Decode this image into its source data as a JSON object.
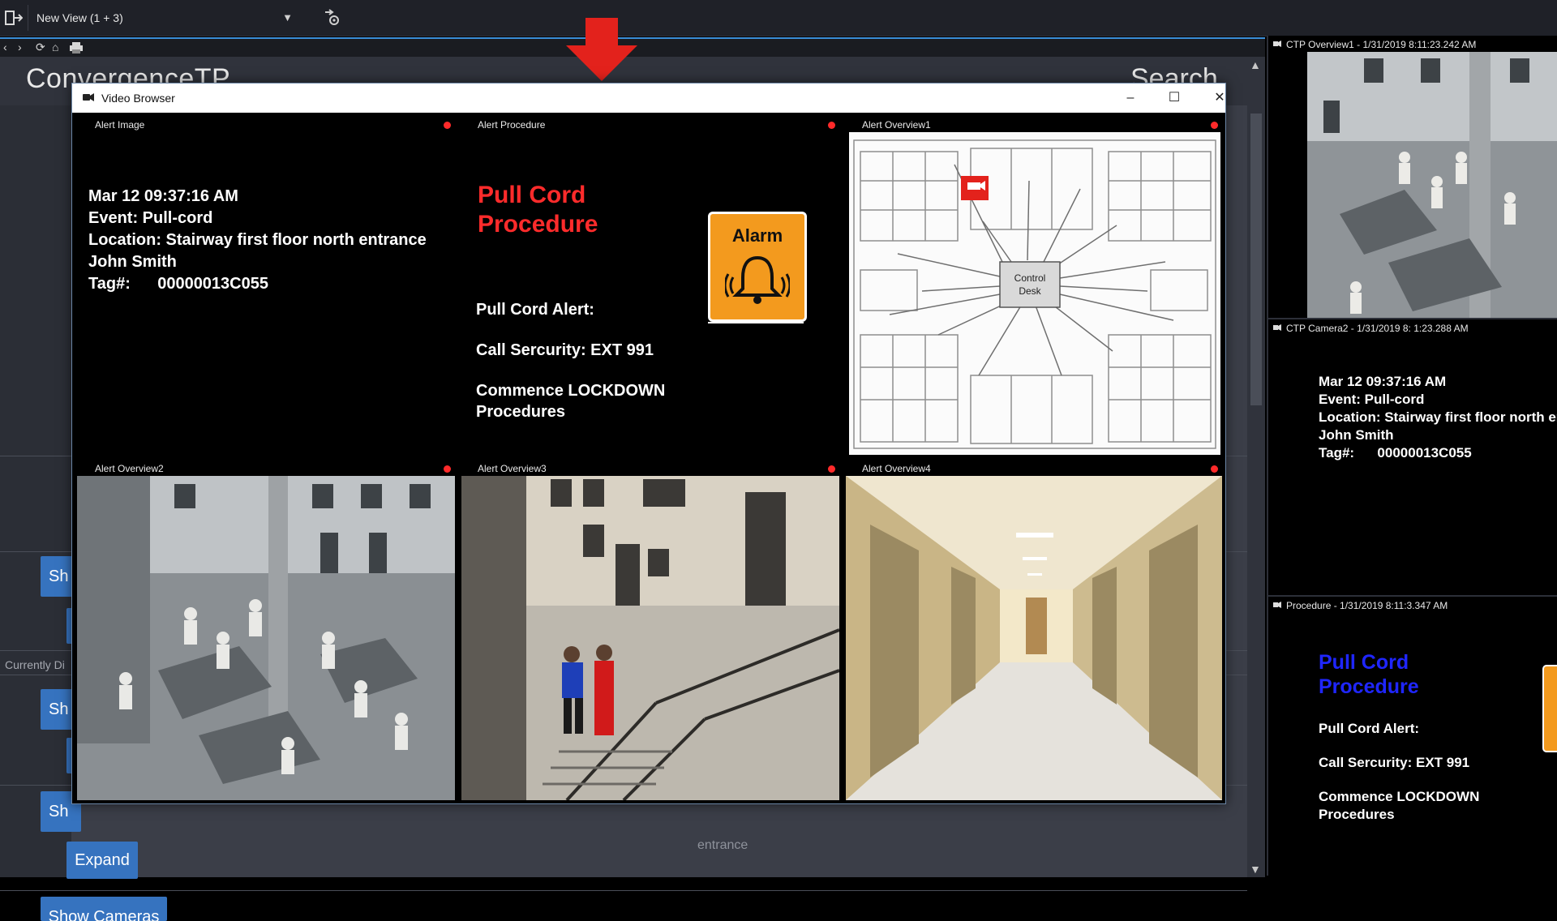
{
  "toolbar": {
    "view_name": "New View (1 + 3)"
  },
  "browser": {
    "brand": "ConvergenceTP",
    "search_heading": "Search",
    "buttons": {
      "show1": "Sh",
      "show2": "Sh",
      "show3": "Sh",
      "expand": "Expand",
      "show_cameras": "Show Cameras"
    },
    "currently_label": "Currently Di",
    "entrance_text": "entrance"
  },
  "window": {
    "title": "Video Browser",
    "minimize": "–",
    "maximize": "☐",
    "close": "✕",
    "panes": {
      "alert_image": {
        "label": "Alert Image",
        "lines": [
          "Mar 12 09:37:16 AM",
          "Event:  Pull-cord",
          "Location: Stairway first floor north entrance",
          "John Smith",
          "Tag#:      00000013C055"
        ]
      },
      "alert_procedure": {
        "label": "Alert Procedure",
        "title_line1": "Pull Cord",
        "title_line2": "Procedure",
        "alarm_word": "Alarm",
        "line1": "Pull Cord Alert:",
        "line2": "Call Sercurity: EXT 991",
        "line3a": "Commence LOCKDOWN",
        "line3b": "Procedures"
      },
      "alert_overview1": {
        "label": "Alert Overview1",
        "control_desk_line1": "Control",
        "control_desk_line2": "Desk"
      },
      "alert_overview2": {
        "label": "Alert Overview2"
      },
      "alert_overview3": {
        "label": "Alert Overview3"
      },
      "alert_overview4": {
        "label": "Alert Overview4"
      }
    }
  },
  "right_column": {
    "camera1_label": "CTP Overview1 - 1/31/2019 8:11:23.242 AM",
    "camera2_label": "CTP Camera2 - 1/31/2019 8: 1:23.288 AM",
    "camera2_lines": [
      "Mar 12 09:37:16 AM",
      "Event:  Pull-cord",
      "Location: Stairway first floor north entrance",
      "John Smith",
      "Tag#:      00000013C055"
    ],
    "procedure_label": "Procedure - 1/31/2019 8:11:3.347 AM",
    "proc_title_line1": "Pull Cord",
    "proc_title_line2": "Procedure",
    "proc_line1": "Pull Cord Alert:",
    "proc_line2": "Call Sercurity: EXT 991",
    "proc_line3a": "Commence LOCKDOWN",
    "proc_line3b": "Procedures"
  },
  "colors": {
    "accent_blue": "#3673bf",
    "alert_red": "#ff2b2b",
    "procedure_blue": "#1f26ff",
    "alarm_orange": "#f39a1e"
  },
  "icons": [
    "exit-icon",
    "setup-icon",
    "back-icon",
    "forward-icon",
    "refresh-icon",
    "home-icon",
    "print-icon",
    "video-browser-icon",
    "camera-tile-icon",
    "alarm-bell-icon",
    "camera-marker-icon"
  ]
}
